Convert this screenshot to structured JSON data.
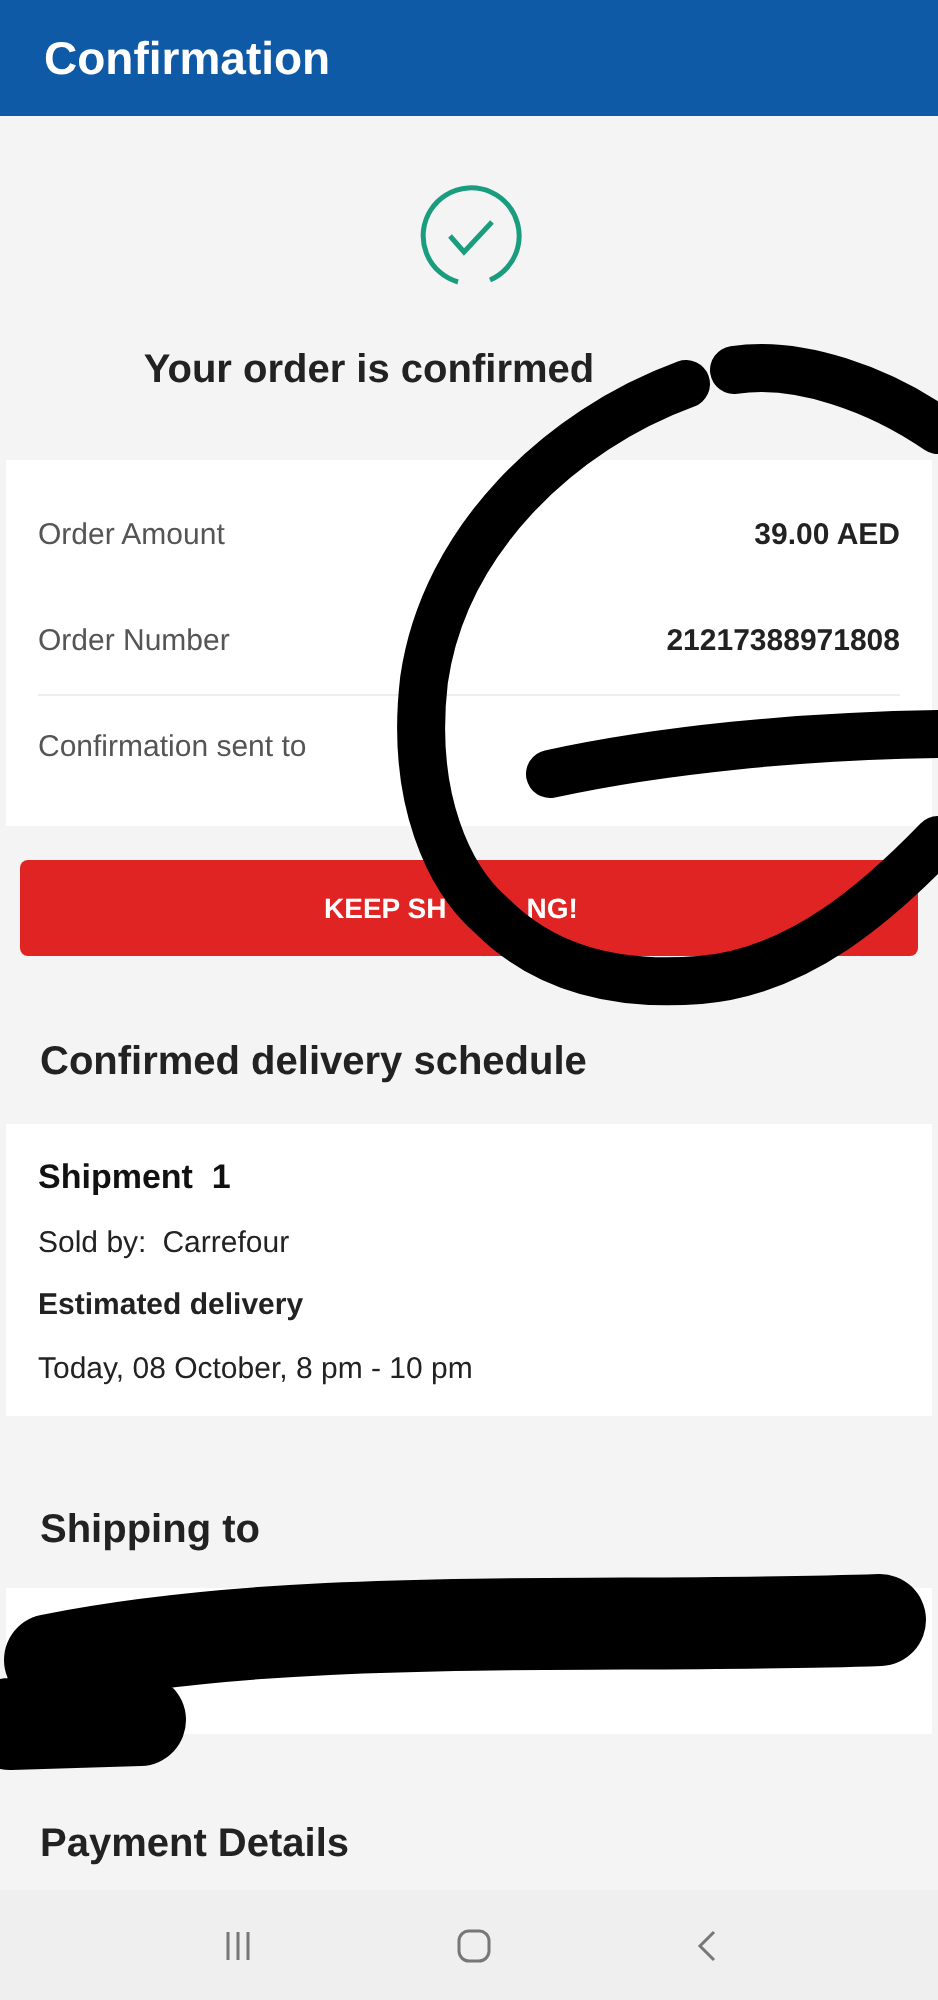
{
  "header": {
    "title": "Confirmation"
  },
  "confirmation": {
    "message": "Your order is confirmed"
  },
  "summary": [
    {
      "label": "Order Amount",
      "value": "39.00 AED"
    },
    {
      "label": "Order Number",
      "value": "21217388971808"
    },
    {
      "label": "Confirmation sent to"
    }
  ],
  "button": {
    "label_parts": [
      "KEEP SH",
      "NG!"
    ]
  },
  "delivery": {
    "title": "Confirmed delivery schedule",
    "shipment": "Shipment  1",
    "sold_by_label": "Sold by:",
    "sold_by": "Carrefour",
    "estimate_label": "Estimated delivery",
    "estimate": "Today, 08 October, 8 pm - 10 pm"
  },
  "shipping": {
    "title": "Shipping to"
  },
  "payment": {
    "title": "Payment Details"
  }
}
